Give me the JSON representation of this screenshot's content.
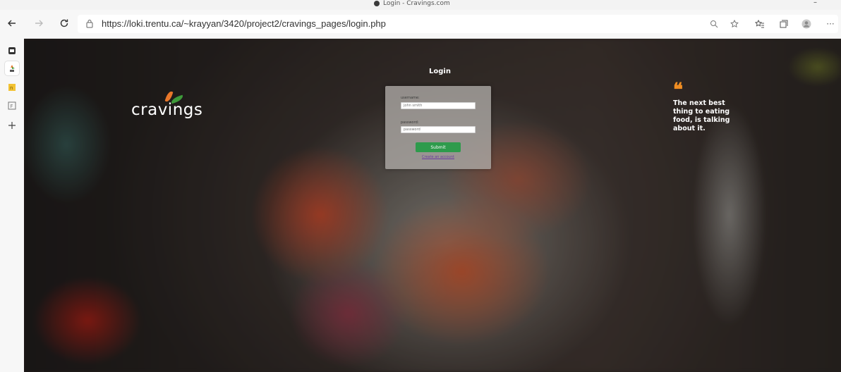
{
  "browser": {
    "tab_title": "Login - Cravings.com",
    "url": "https://loki.trentu.ca/~krayyan/3420/project2/cravings_pages/login.php",
    "back_icon": "arrow-left-icon",
    "forward_icon": "arrow-right-icon",
    "refresh_icon": "refresh-icon",
    "lock_icon": "lock-icon",
    "toolbar_icons": [
      "zoom-icon",
      "read-aloud-icon",
      "favorites-icon",
      "collections-icon",
      "profile-icon",
      "more-icon"
    ]
  },
  "sidebar": {
    "items": [
      "tab-icon-1",
      "tab-icon-2",
      "tab-icon-3",
      "tab-icon-4",
      "add-icon"
    ]
  },
  "page": {
    "logo_text": "cravings",
    "login_title": "Login",
    "form": {
      "username_label": "username:",
      "username_placeholder": "john smith",
      "password_label": "password:",
      "password_placeholder": "password",
      "submit_label": "Submit",
      "create_account_link": "Create an account"
    },
    "quote_mark": "❝",
    "quote_text": "The next best thing to eating food, is talking about it."
  },
  "colors": {
    "accent_orange": "#f08d22",
    "submit_green": "#2e9b4c",
    "link_purple": "#6a3aa0"
  }
}
